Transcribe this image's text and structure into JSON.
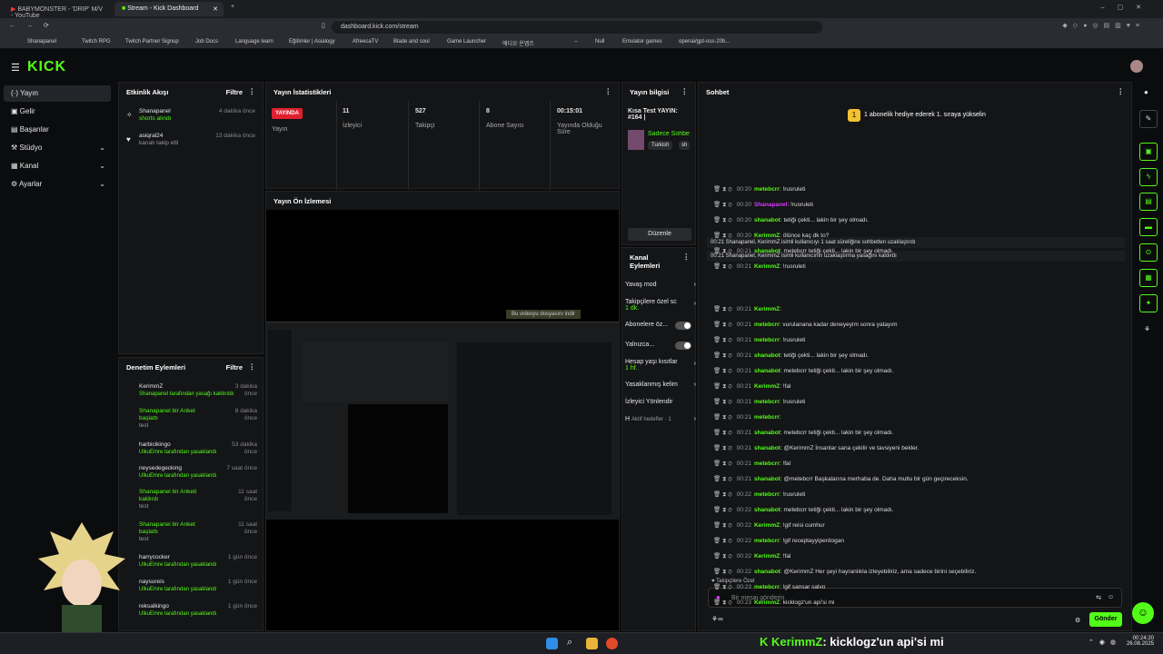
{
  "browser": {
    "tab1": "BABYMONSTER - 'DRIP' M/V - YouTube",
    "tab2": "Stream - Kick Dashboard",
    "url": "dashboard.kick.com/stream",
    "bookmarks": [
      "Shanapanel",
      "Twitch RPG",
      "Twitch Partner Signup",
      "Job Docs",
      "Language learn",
      "Eğitimler | Asialogy",
      "AfreecaTV",
      "Blade and soul",
      "Game Launcher",
      "에디오 온앱즈",
      "--",
      "Null",
      "Emulator games",
      "openai/gpt-oss-20b..."
    ]
  },
  "app": {
    "logo": "KICK"
  },
  "nav": [
    {
      "label": "Yayın"
    },
    {
      "label": "Gelir"
    },
    {
      "label": "Başarılar"
    },
    {
      "label": "Stüdyo"
    },
    {
      "label": "Kanal"
    },
    {
      "label": "Ayarlar"
    }
  ],
  "activity": {
    "title": "Etkinlik Akışı",
    "filter": "Filtre",
    "items": [
      {
        "name": "Shanapanel",
        "desc": "shorts alındı",
        "time": "4 dakika önce"
      },
      {
        "name": "asiqral24",
        "desc": "kanalı takip etti",
        "time": "13 dakika önce"
      }
    ]
  },
  "stats": {
    "title": "Yayın İstatistikleri",
    "badge": "YAYINDA",
    "badge_label": "Yayın",
    "items": [
      {
        "v": "11",
        "l": "İzleyici"
      },
      {
        "v": "527",
        "l": "Takipçi"
      },
      {
        "v": "8",
        "l": "Abone Sayısı"
      },
      {
        "v": "00:15:01",
        "l": "Yayında Olduğu Süre"
      }
    ]
  },
  "info": {
    "title": "Yayın bilgisi",
    "stream_title": "Kısa Test YAYIN: #164 |",
    "category": "Sadece Sohbe",
    "tags": [
      "Turkish",
      "sh"
    ],
    "edit": "Düzenle"
  },
  "preview": {
    "title": "Yayın Ön İzlemesi",
    "tooltip": "Bu videoyu dosyasını indir"
  },
  "channel_actions": {
    "title": "Kanal Eylemleri",
    "items": [
      {
        "label": "Yavaş mod",
        "sub": ""
      },
      {
        "label": "Takipçilere özel sc",
        "sub": "1 dk."
      },
      {
        "label": "Abonelere öz...",
        "sub": ""
      },
      {
        "label": "Yalnızca...",
        "sub": ""
      },
      {
        "label": "Hesap yaşı kısıtlar",
        "sub": "1 hf."
      },
      {
        "label": "Yasaklanmış kelim",
        "sub": ""
      },
      {
        "label": "İzleyici Yönlendir",
        "sub": ""
      },
      {
        "label": "H",
        "sub": "Aktif hedefler · 1"
      }
    ]
  },
  "moderation": {
    "title": "Denetim Eylemleri",
    "filter": "Filtre",
    "items": [
      {
        "name": "KerimmZ",
        "desc": "Shanapanel tarafından yasağı kaldırıldı",
        "time": "3 dakika önce",
        "extra": ""
      },
      {
        "name": "Shanapanel bir Anket başlattı",
        "desc": "test",
        "time": "8 dakika önce",
        "extra": ""
      },
      {
        "name": "harbicikingo",
        "desc": "UlkuEmre tarafından yasaklandı",
        "time": "53 dakika önce",
        "extra": ""
      },
      {
        "name": "neysedegecking",
        "desc": "UlkuEmre tarafından yasaklandı",
        "time": "7 saat önce",
        "extra": ""
      },
      {
        "name": "Shanapanel bir Anketi kaldırdı",
        "desc": "test",
        "time": "11 saat önce",
        "extra": ""
      },
      {
        "name": "Shanapanel bir Anket başlattı",
        "desc": "test",
        "time": "11 saat önce",
        "extra": ""
      },
      {
        "name": "harrycocker",
        "desc": "UlkuEmre tarafından yasaklandı",
        "time": "1 gün önce",
        "extra": ""
      },
      {
        "name": "naysureis",
        "desc": "UlkuEmre tarafından yasaklandı",
        "time": "1 gün önce",
        "extra": ""
      },
      {
        "name": "reksalkingo",
        "desc": "UlkuEmre tarafından yasaklandı",
        "time": "1 gün önce",
        "extra": ""
      }
    ]
  },
  "chat": {
    "title": "Sohbet",
    "banner": "1 abonelik hediye ederek 1. sıraya yükselin",
    "footer_label": "Takipçilere Özel",
    "placeholder": "Bir mesaj gönderin",
    "send": "Gönder",
    "messages": [
      {
        "t": "00:20",
        "u": "metebcrr",
        "m": ": !rusruleti",
        "c": "#53fc18"
      },
      {
        "t": "00:20",
        "u": "Shanapanel",
        "m": ": !rusruleti",
        "c": "#d43bff"
      },
      {
        "t": "00:20",
        "u": "shanabot",
        "m": ": tetiği çekti... lakin bir şey olmadı.",
        "c": "#53fc18"
      },
      {
        "t": "00:20",
        "u": "KerimmZ",
        "m": ": ölünce kaç dk to?",
        "c": "#53fc18"
      },
      {
        "t": "00:21",
        "u": "shanabot",
        "m": ": metebcrr tetiği çekti... lakin bir şey olmadı.",
        "c": "#53fc18"
      },
      {
        "t": "00:21",
        "u": "KerimmZ",
        "m": ": !rusruleti",
        "c": "#53fc18"
      },
      {
        "t": "00:21",
        "u": "KerimmZ",
        "m": ":",
        "c": "#53fc18"
      },
      {
        "t": "00:21",
        "u": "metebcrr",
        "m": ": vurulanana kadar deneyeyim sonra yatayım",
        "c": "#53fc18"
      },
      {
        "t": "00:21",
        "u": "metebcrr",
        "m": ": !rusruleti",
        "c": "#53fc18"
      },
      {
        "t": "00:21",
        "u": "shanabot",
        "m": ": tetiği çekti... lakin bir şey olmadı.",
        "c": "#53fc18"
      },
      {
        "t": "00:21",
        "u": "shanabot",
        "m": ": metebcrr tetiği çekti... lakin bir şey olmadı.",
        "c": "#53fc18"
      },
      {
        "t": "00:21",
        "u": "KerimmZ",
        "m": ": !fal",
        "c": "#53fc18"
      },
      {
        "t": "00:21",
        "u": "metebcrr",
        "m": ": !rusruleti",
        "c": "#53fc18"
      },
      {
        "t": "00:21",
        "u": "metebcrr",
        "m": ":",
        "c": "#53fc18"
      },
      {
        "t": "00:21",
        "u": "shanabot",
        "m": ": metebcrr tetiği çekti... lakin bir şey olmadı.",
        "c": "#53fc18"
      },
      {
        "t": "00:21",
        "u": "shanabot",
        "m": ": @KerimmZ İnsanlar sana çekilir ve tavsiyeni bekler.",
        "c": "#53fc18"
      },
      {
        "t": "00:21",
        "u": "metebcrr",
        "m": ": !fal",
        "c": "#53fc18"
      },
      {
        "t": "00:21",
        "u": "shanabot",
        "m": ": @metebcrr Başkalarına merhaba de. Daha mutlu bir gün geçireceksin.",
        "c": "#53fc18"
      },
      {
        "t": "00:22",
        "u": "metebcrr",
        "m": ": !rusruleti",
        "c": "#53fc18"
      },
      {
        "t": "00:22",
        "u": "shanabot",
        "m": ": metebcrr tetiği çekti... lakin bir şey olmadı.",
        "c": "#53fc18"
      },
      {
        "t": "00:22",
        "u": "KerimmZ",
        "m": ": !gif reisi cumhur",
        "c": "#53fc18"
      },
      {
        "t": "00:22",
        "u": "metebcrr",
        "m": ": !gif receptayyiperdogan",
        "c": "#53fc18"
      },
      {
        "t": "00:22",
        "u": "KerimmZ",
        "m": ": !fal",
        "c": "#53fc18"
      },
      {
        "t": "00:22",
        "u": "shanabot",
        "m": ": @KerimmZ Her şeyi hayranlıkla izleyebiliriz, ama sadece birini seçebiliriz.",
        "c": "#53fc18"
      },
      {
        "t": "00:23",
        "u": "metebcrr",
        "m": ": !gif sansar salvo",
        "c": "#53fc18"
      },
      {
        "t": "00:23",
        "u": "KerimmZ",
        "m": ": kicklogz'un api'si mi",
        "c": "#53fc18"
      }
    ],
    "system": [
      "00:21 Shanapanel, KerimmZ isimli kullanıcıyı 1 saat süreliğine sohbetten uzaklaştırdı",
      "00:21 Shanapanel, KerimmZ isimli kullanıcının uzaklaştırma yasağını kaldırdı"
    ]
  },
  "overlay": {
    "user": "KerimmZ",
    "text": ": kicklogz'un api'si mi"
  },
  "taskbar": {
    "time": "00:24:20",
    "date": "26.08.2025"
  }
}
